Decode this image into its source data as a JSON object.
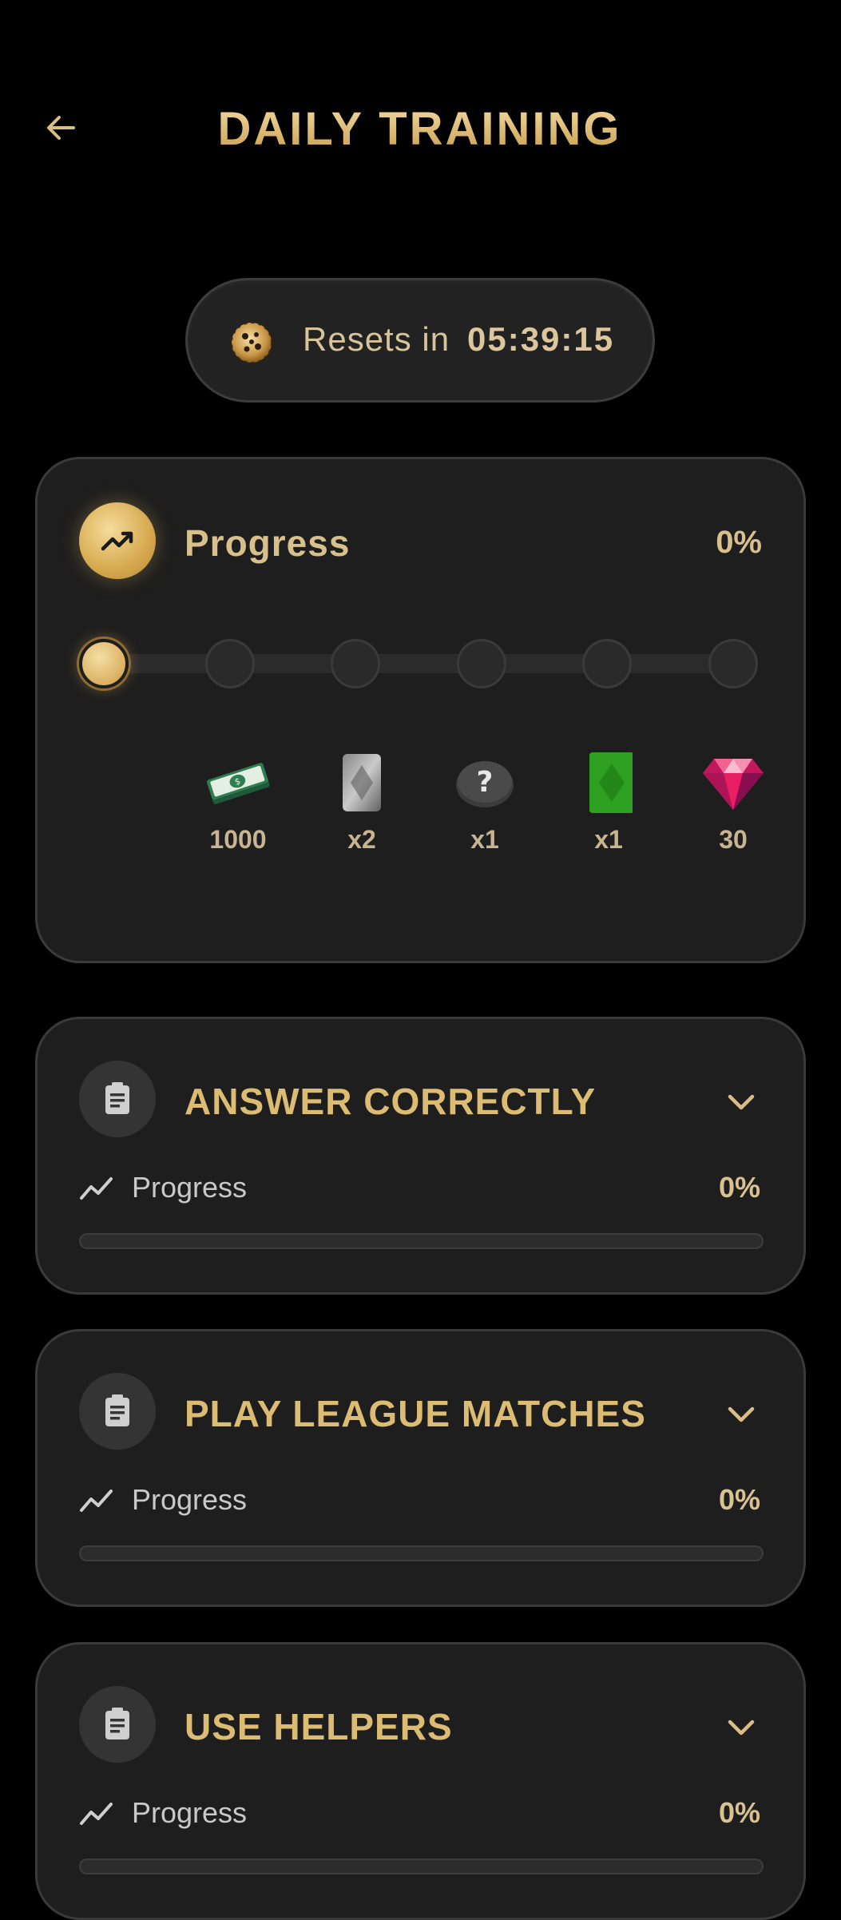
{
  "header": {
    "title": "DAILY TRAINING",
    "back_icon": "arrow-left-icon"
  },
  "reset": {
    "label": "Resets in",
    "time": "05:39:15",
    "icon": "timer-icon"
  },
  "overall_progress": {
    "title": "Progress",
    "value": "0%",
    "fraction": 0,
    "icon": "trending-up-icon",
    "milestones_reached": 1,
    "milestones_total": 6,
    "rewards": [
      {
        "icon": "cash-stack-icon",
        "amount": "1000"
      },
      {
        "icon": "silver-card-icon",
        "amount": "x2"
      },
      {
        "icon": "mystery-coin-icon",
        "amount": "x1"
      },
      {
        "icon": "green-card-icon",
        "amount": "x1"
      },
      {
        "icon": "gem-icon",
        "amount": "30"
      }
    ]
  },
  "tasks": [
    {
      "title": "ANSWER CORRECTLY",
      "progress_label": "Progress",
      "progress_value": "0%",
      "fraction": 0
    },
    {
      "title": "PLAY LEAGUE MATCHES",
      "progress_label": "Progress",
      "progress_value": "0%",
      "fraction": 0
    },
    {
      "title": "USE HELPERS",
      "progress_label": "Progress",
      "progress_value": "0%",
      "fraction": 0
    }
  ],
  "colors": {
    "gold": "#dcbc72",
    "card_bg": "#1e1e1e",
    "background": "#000000"
  }
}
